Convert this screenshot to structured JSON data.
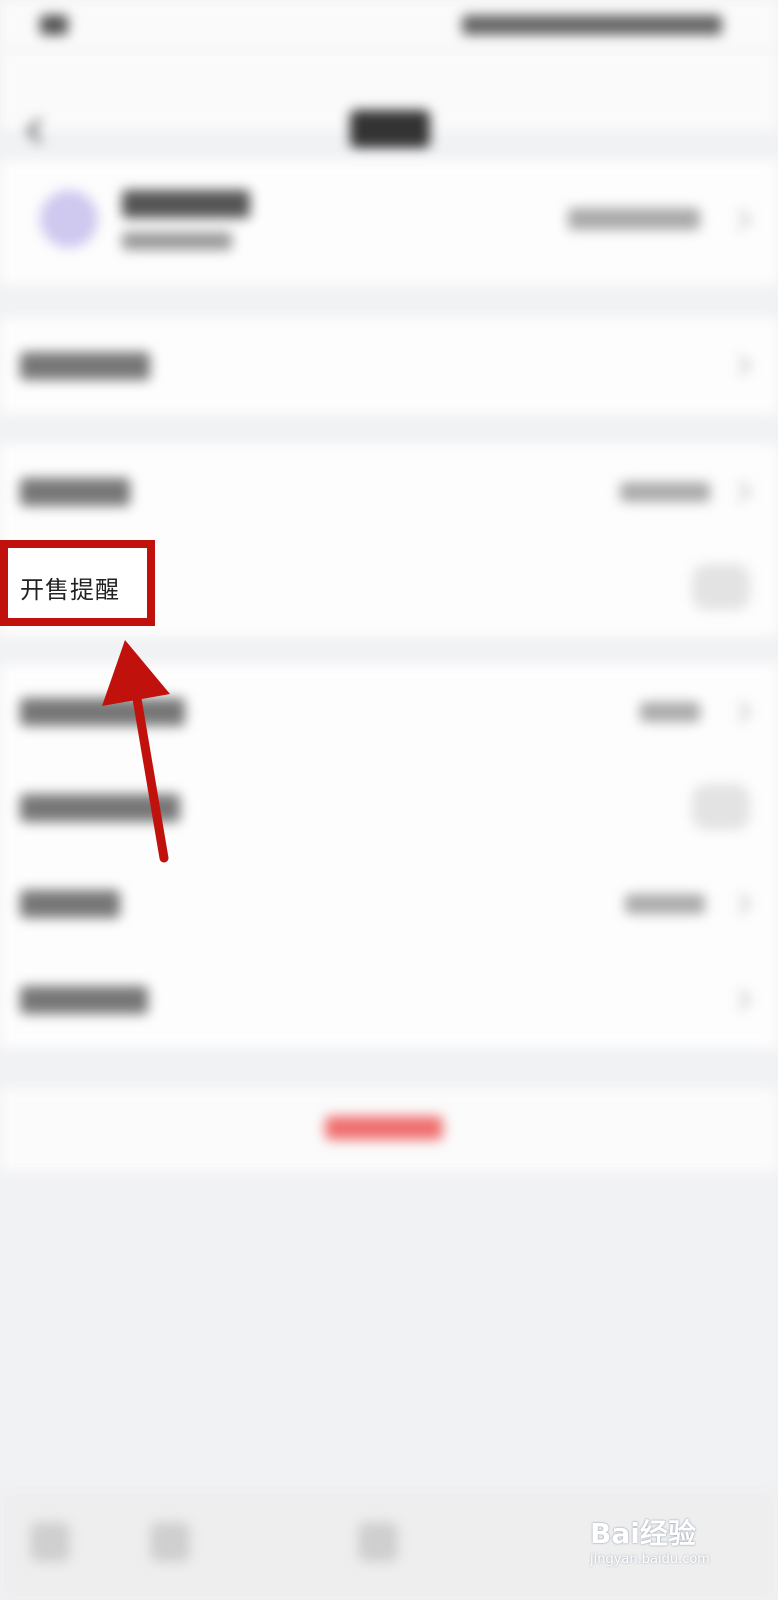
{
  "highlight": {
    "label": "开售提醒",
    "border_color": "#c0110d"
  },
  "arrow": {
    "color": "#c0110d"
  },
  "watermark": {
    "brand": "Bai经验",
    "url": "jingyan.baidu.com"
  },
  "accent": {
    "logout_red": "#f07070"
  }
}
